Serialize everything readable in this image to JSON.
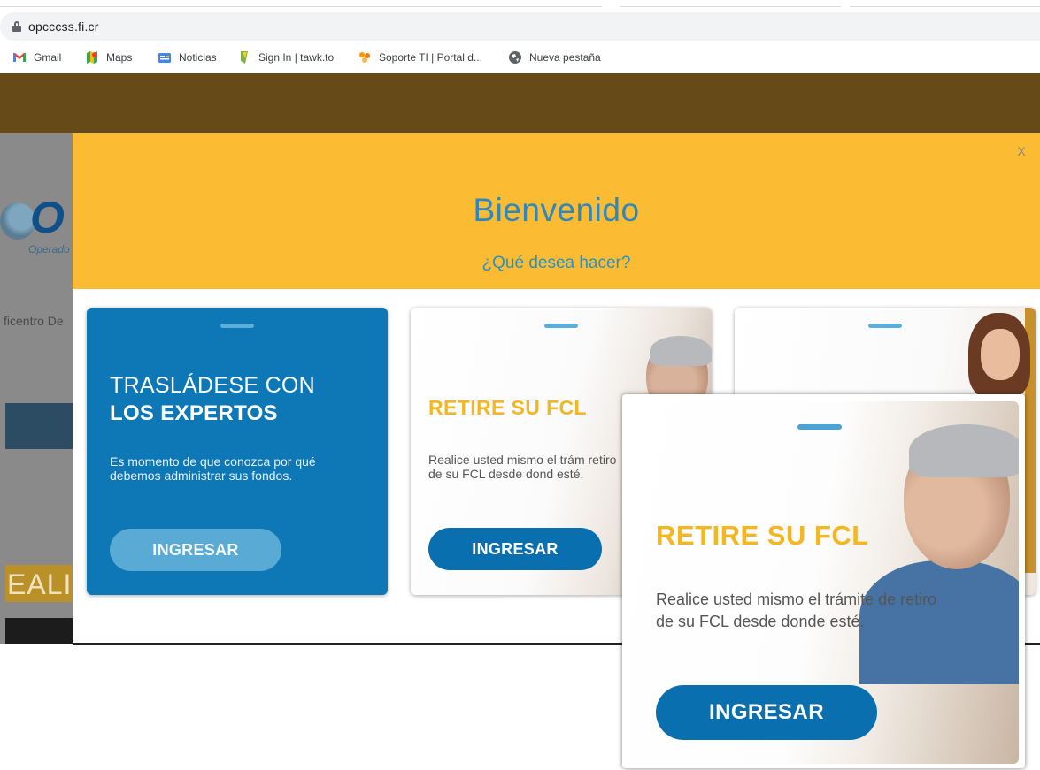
{
  "browser": {
    "url": "opcccss.fi.cr",
    "bookmarks": [
      {
        "label": "Gmail",
        "icon": "gmail-icon"
      },
      {
        "label": "Maps",
        "icon": "maps-icon"
      },
      {
        "label": "Noticias",
        "icon": "news-icon"
      },
      {
        "label": "Sign In | tawk.to",
        "icon": "tawkto-icon"
      },
      {
        "label": "Soporte TI | Portal d...",
        "icon": "support-portal-icon"
      },
      {
        "label": "Nueva pestaña",
        "icon": "globe-icon"
      }
    ]
  },
  "site": {
    "logo_letter": "O",
    "logo_subtitle": "Operado",
    "text_fragment": "ficentro De",
    "banner_fragment": "EALI"
  },
  "modal": {
    "close_label": "X",
    "title": "Bienvenido",
    "subtitle": "¿Qué desea hacer?",
    "cards": [
      {
        "title_line1": "TRASLÁDESE CON",
        "title_line2": "LOS EXPERTOS",
        "body": "Es momento de que conozca por qué debemos administrar sus fondos.",
        "button": "INGRESAR"
      },
      {
        "title": "RETIRE SU FCL",
        "body": "Realice usted mismo el trám retiro de su FCL desde dond esté.",
        "button": "INGRESAR"
      },
      {
        "title": "",
        "body": "",
        "button": ""
      }
    ]
  },
  "zoom_inset": {
    "title": "RETIRE SU FCL",
    "body": "Realice usted mismo el trámite de retiro de su FCL desde donde esté.",
    "button": "INGRESAR"
  },
  "colors": {
    "header_brown": "#664b18",
    "modal_yellow": "#fbbc33",
    "title_blue": "#2f87bb",
    "card_blue": "#0e77b5",
    "button_blue": "#0a6fae",
    "accent_yellow": "#f4b621"
  }
}
